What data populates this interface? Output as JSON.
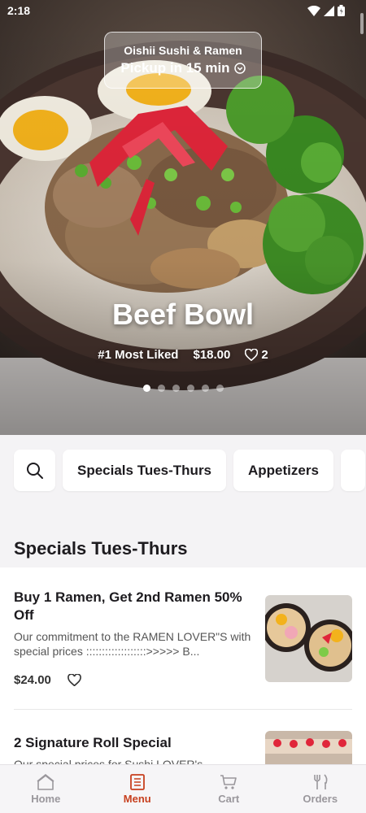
{
  "status_bar": {
    "time": "2:18"
  },
  "store": {
    "name": "Oishii Sushi & Ramen",
    "pickup": "Pickup in 15 min"
  },
  "featured": {
    "title": "Beef Bowl",
    "rank": "#1 Most Liked",
    "price": "$18.00",
    "likes": "2",
    "carousel_count": 6,
    "carousel_active_index": 0
  },
  "tabs": [
    {
      "label": "Specials Tues-Thurs"
    },
    {
      "label": "Appetizers"
    }
  ],
  "section": {
    "title": "Specials Tues-Thurs"
  },
  "items": [
    {
      "title": "Buy 1 Ramen, Get 2nd Ramen 50% Off",
      "description": "Our commitment to the RAMEN LOVER\"S with special prices :::::::::::::::::::>>>>> B...",
      "price": "$24.00"
    },
    {
      "title": "2 Signature Roll Special",
      "description": "Our special prices for Sushi LOVER's"
    }
  ],
  "bottom_nav": [
    {
      "label": "Home",
      "icon": "home-icon"
    },
    {
      "label": "Menu",
      "icon": "menu-icon",
      "active": true
    },
    {
      "label": "Cart",
      "icon": "cart-icon"
    },
    {
      "label": "Orders",
      "icon": "orders-icon"
    }
  ],
  "colors": {
    "accent": "#c7401f",
    "background": "#f4f3f5"
  }
}
